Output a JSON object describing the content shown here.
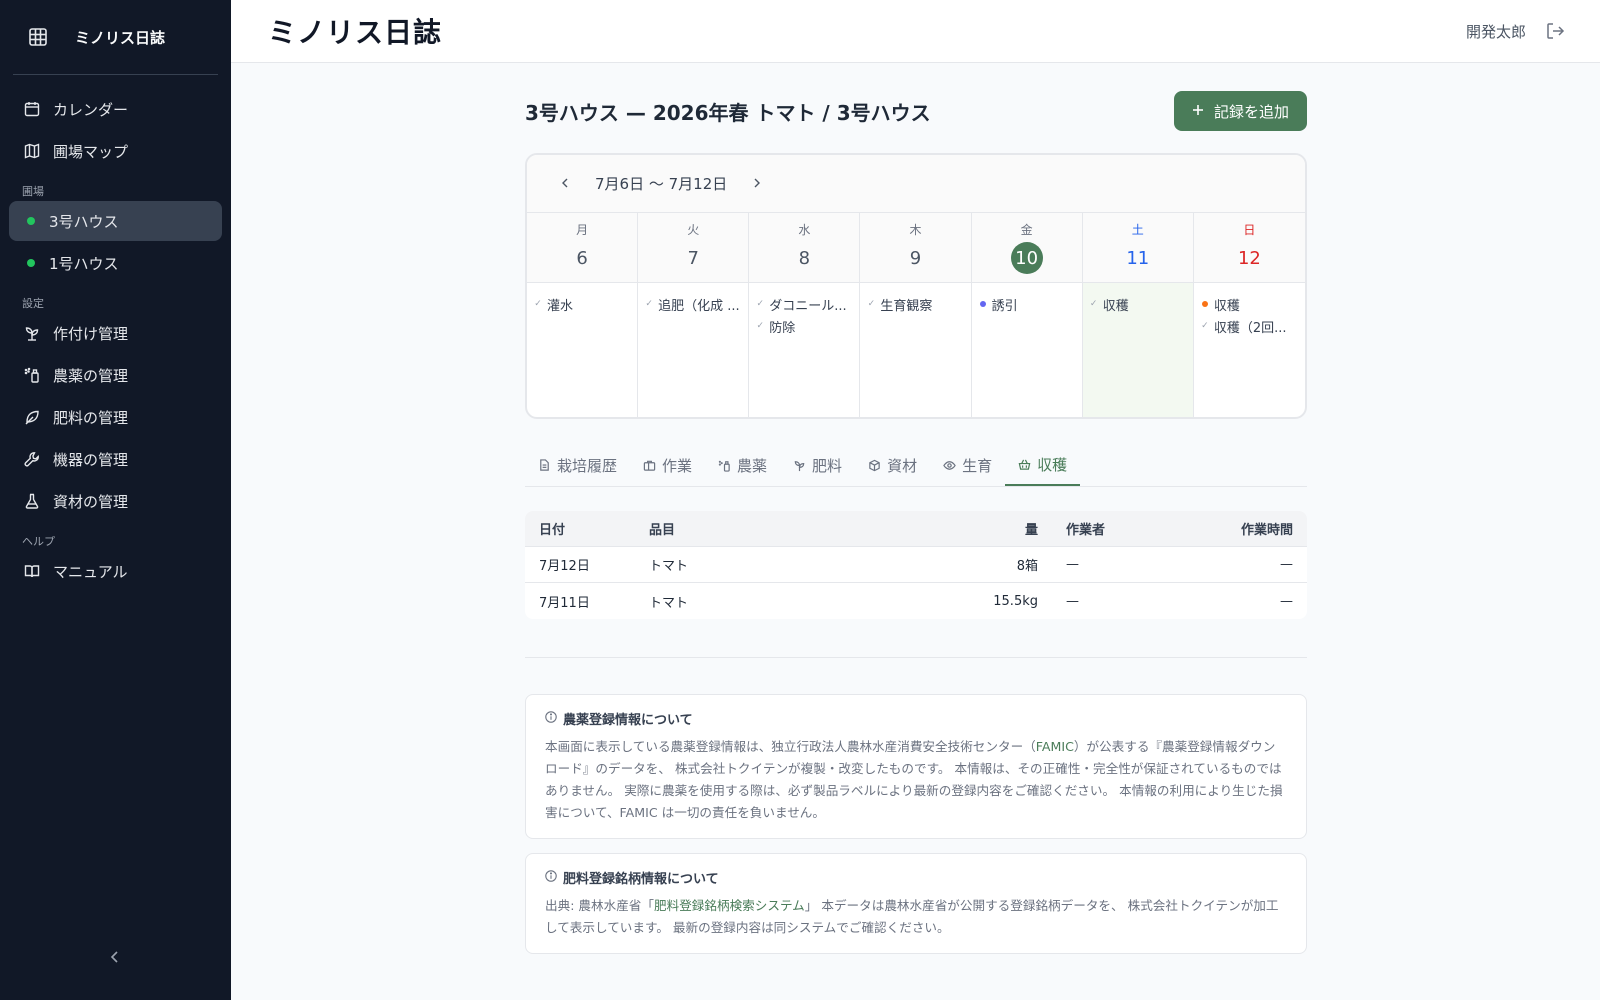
{
  "app": {
    "name": "ミノリス日誌",
    "header_title": "ミノリス日誌",
    "user": "開発太郎"
  },
  "sidebar": {
    "top_items": [
      {
        "label": "カレンダー",
        "icon": "calendar-icon"
      },
      {
        "label": "圃場マップ",
        "icon": "map-icon"
      }
    ],
    "section_fields": "圃場",
    "fields": [
      {
        "label": "3号ハウス",
        "active": true
      },
      {
        "label": "1号ハウス",
        "active": false
      }
    ],
    "section_settings": "設定",
    "settings_items": [
      {
        "label": "作付け管理",
        "icon": "sprout-icon"
      },
      {
        "label": "農薬の管理",
        "icon": "spray-icon"
      },
      {
        "label": "肥料の管理",
        "icon": "leaf-icon"
      },
      {
        "label": "機器の管理",
        "icon": "wrench-icon"
      },
      {
        "label": "資材の管理",
        "icon": "flask-icon"
      }
    ],
    "section_help": "ヘルプ",
    "help_items": [
      {
        "label": "マニュアル",
        "icon": "book-icon"
      }
    ]
  },
  "main": {
    "title": "3号ハウス — 2026年春 トマト / 3号ハウス",
    "add_button": "記録を追加",
    "calendar": {
      "range": "7月6日 〜 7月12日",
      "days": [
        {
          "dow": "月",
          "num": "6",
          "type": "",
          "today": false
        },
        {
          "dow": "火",
          "num": "7",
          "type": "",
          "today": false
        },
        {
          "dow": "水",
          "num": "8",
          "type": "",
          "today": false
        },
        {
          "dow": "木",
          "num": "9",
          "type": "",
          "today": false
        },
        {
          "dow": "金",
          "num": "10",
          "type": "",
          "today": true
        },
        {
          "dow": "土",
          "num": "11",
          "type": "sat",
          "today": false
        },
        {
          "dow": "日",
          "num": "12",
          "type": "sun",
          "today": false
        }
      ],
      "events": [
        [
          {
            "text": "灌水",
            "marker": "check"
          }
        ],
        [
          {
            "text": "追肥（化成 ...",
            "marker": "check"
          }
        ],
        [
          {
            "text": "ダコニール...",
            "marker": "check"
          },
          {
            "text": "防除",
            "marker": "check"
          }
        ],
        [
          {
            "text": "生育観察",
            "marker": "check"
          }
        ],
        [
          {
            "text": "誘引",
            "marker": "dot",
            "color": "#6366f1"
          }
        ],
        [
          {
            "text": "収穫",
            "marker": "check"
          }
        ],
        [
          {
            "text": "収穫",
            "marker": "dot",
            "color": "#f97316"
          },
          {
            "text": "収穫（2回...",
            "marker": "check"
          }
        ]
      ]
    },
    "tabs": [
      {
        "label": "栽培履歴",
        "icon": "document-icon",
        "active": false
      },
      {
        "label": "作業",
        "icon": "briefcase-icon",
        "active": false
      },
      {
        "label": "農薬",
        "icon": "spray-icon",
        "active": false
      },
      {
        "label": "肥料",
        "icon": "sprout-icon",
        "active": false
      },
      {
        "label": "資材",
        "icon": "box-icon",
        "active": false
      },
      {
        "label": "生育",
        "icon": "eye-icon",
        "active": false
      },
      {
        "label": "収穫",
        "icon": "basket-icon",
        "active": true
      }
    ],
    "table": {
      "headers": {
        "date": "日付",
        "item": "品目",
        "amount": "量",
        "worker": "作業者",
        "time": "作業時間"
      },
      "rows": [
        {
          "date": "7月12日",
          "item": "トマト",
          "amount": "8箱",
          "worker": "—",
          "time": "—"
        },
        {
          "date": "7月11日",
          "item": "トマト",
          "amount": "15.5kg",
          "worker": "—",
          "time": "—"
        }
      ]
    },
    "notices": {
      "pesticide": {
        "title": "農薬登録情報について",
        "body_1": "本画面に表示している農薬登録情報は、独立行政法人農林水産消費安全技術センター（",
        "link": "FAMIC",
        "body_2": "）が公表する『農薬登録情報ダウンロード』のデータを、 株式会社トクイテンが複製・改変したものです。 本情報は、その正確性・完全性が保証されているものではありません。 実際に農薬を使用する際は、必ず製品ラベルにより最新の登録内容をご確認ください。 本情報の利用により生じた損害について、FAMIC は一切の責任を負いません。"
      },
      "fertilizer": {
        "title": "肥料登録銘柄情報について",
        "body_1": "出典: 農林水産省「",
        "link": "肥料登録銘柄検索システム",
        "body_2": "」 本データは農林水産省が公開する登録銘柄データを、 株式会社トクイテンが加工して表示しています。 最新の登録内容は同システムでご確認ください。"
      }
    }
  }
}
